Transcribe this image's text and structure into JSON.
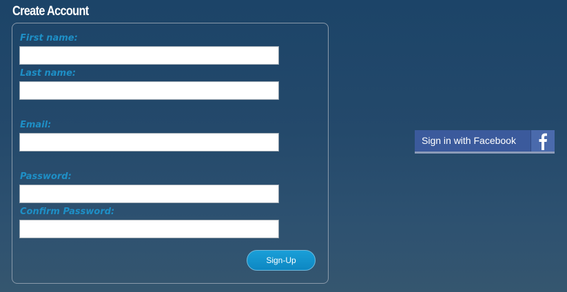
{
  "page": {
    "title": "Create Account"
  },
  "form": {
    "fields": [
      {
        "label": "First name:",
        "value": "",
        "placeholder": ""
      },
      {
        "label": "Last name:",
        "value": "",
        "placeholder": ""
      },
      {
        "label": "Email:",
        "value": "",
        "placeholder": ""
      },
      {
        "label": "Password:",
        "value": "",
        "placeholder": ""
      },
      {
        "label": "Confirm Password:",
        "value": "",
        "placeholder": ""
      }
    ],
    "submit_label": "Sign-Up"
  },
  "social": {
    "facebook_label": "Sign in with Facebook",
    "facebook_icon": "facebook-f-icon"
  },
  "colors": {
    "background": "#1c4468",
    "label": "#1e8fc6",
    "button": "#0d87c2",
    "facebook": "#3b5a9c"
  }
}
